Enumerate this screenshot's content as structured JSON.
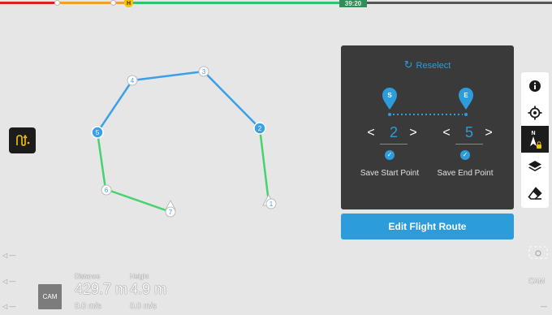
{
  "top_bar": {
    "battery_time": "39:20",
    "home_marker": "H",
    "colors": {
      "critical": "#e02020",
      "low": "#f0a030",
      "ok": "#36c26a"
    }
  },
  "map": {
    "route_colors": {
      "selected": "#3aa0e8",
      "unselected": "#46d36e"
    },
    "waypoints": [
      {
        "label": "1"
      },
      {
        "label": "2"
      },
      {
        "label": "3"
      },
      {
        "label": "4"
      },
      {
        "label": "5"
      },
      {
        "label": "6"
      },
      {
        "label": "7"
      }
    ]
  },
  "left_tool": {
    "icon": "route-path-icon"
  },
  "panel": {
    "reselect_label": "Reselect",
    "start": {
      "pin": "S",
      "value": "2",
      "save_label": "Save Start Point",
      "checked": true
    },
    "end": {
      "pin": "E",
      "value": "5",
      "save_label": "Save End Point",
      "checked": true
    },
    "prev_glyph": "<",
    "next_glyph": ">",
    "check_glyph": "✓"
  },
  "edit_route_label": "Edit Flight Route",
  "toolbar": {
    "items": [
      {
        "icon": "info-icon"
      },
      {
        "icon": "locate-icon"
      },
      {
        "icon": "compass-north-lock-icon",
        "label": "N"
      },
      {
        "icon": "layers-icon"
      },
      {
        "icon": "eraser-icon"
      }
    ]
  },
  "telemetry": {
    "cam_label": "CAM",
    "distance_label": "Distance",
    "distance_value": "429.7 m",
    "distance_speed": "0.0 m/s",
    "height_label": "Height",
    "height_value": "4.9 m",
    "height_speed": "0.0 m/s"
  },
  "right_edge": {
    "cam_label": "CAM"
  }
}
